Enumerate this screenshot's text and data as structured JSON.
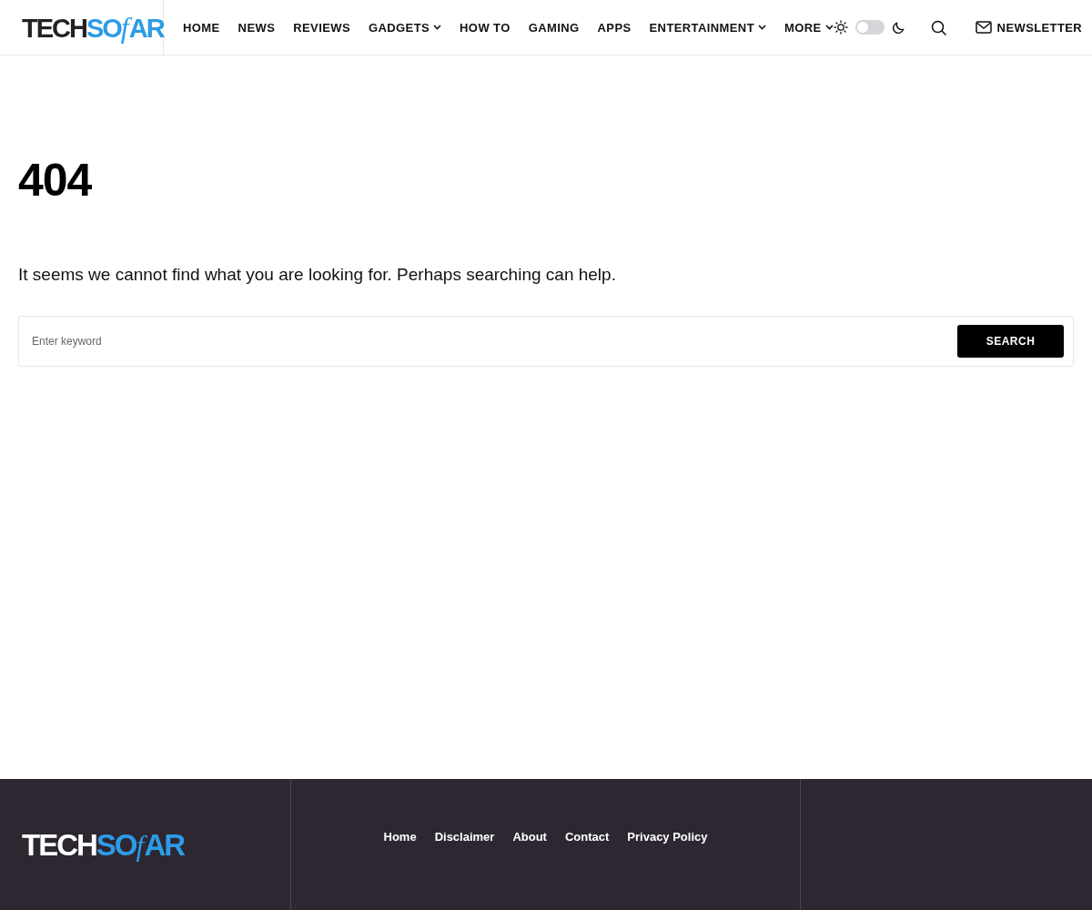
{
  "header": {
    "logo": [
      {
        "kind": "plain",
        "text": "TECH"
      },
      {
        "kind": "accent",
        "text": "SO"
      },
      {
        "kind": "script",
        "text": "f"
      },
      {
        "kind": "accent",
        "text": "AR"
      }
    ],
    "nav": [
      {
        "label": "HOME",
        "dropdown": false
      },
      {
        "label": "NEWS",
        "dropdown": false
      },
      {
        "label": "REVIEWS",
        "dropdown": false
      },
      {
        "label": "GADGETS",
        "dropdown": true
      },
      {
        "label": "HOW TO",
        "dropdown": false
      },
      {
        "label": "GAMING",
        "dropdown": false
      },
      {
        "label": "APPS",
        "dropdown": false
      },
      {
        "label": "ENTERTAINMENT",
        "dropdown": true
      },
      {
        "label": "MORE",
        "dropdown": true
      }
    ],
    "dark_mode": {
      "on": false
    },
    "newsletter": "NEWSLETTER"
  },
  "main": {
    "title": "404",
    "message": "It seems we cannot find what you are looking for. Perhaps searching can help.",
    "search": {
      "placeholder": "Enter keyword",
      "button": "SEARCH"
    }
  },
  "footer": {
    "logo": [
      {
        "kind": "plain",
        "text": "TECH"
      },
      {
        "kind": "accent",
        "text": "SO"
      },
      {
        "kind": "script",
        "text": "f"
      },
      {
        "kind": "accent",
        "text": "AR"
      }
    ],
    "links": [
      "Home",
      "Disclaimer",
      "About",
      "Contact",
      "Privacy Policy"
    ]
  }
}
